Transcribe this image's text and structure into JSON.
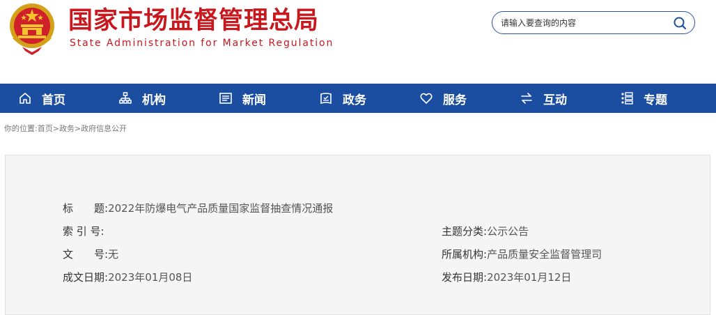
{
  "header": {
    "title": "国家市场监督管理总局",
    "subtitle": "State Administration for Market Regulation",
    "emblem": "national-emblem"
  },
  "search": {
    "placeholder": "请输入要查询的内容",
    "icon": "search-icon"
  },
  "nav": {
    "items": [
      {
        "label": "首页",
        "icon": "home-icon"
      },
      {
        "label": "机构",
        "icon": "org-chart-icon"
      },
      {
        "label": "新闻",
        "icon": "newspaper-icon"
      },
      {
        "label": "政务",
        "icon": "book-icon"
      },
      {
        "label": "服务",
        "icon": "heart-icon"
      },
      {
        "label": "互动",
        "icon": "swap-icon"
      },
      {
        "label": "专题",
        "icon": "topics-icon"
      }
    ]
  },
  "breadcrumb": {
    "prefix": "你的位置:",
    "items": [
      "首页",
      "政务",
      "政府信息公开"
    ],
    "separator": ">"
  },
  "info": {
    "title_label": "标　　题:",
    "title_value": "2022年防爆电气产品质量国家监督抽查情况通报",
    "index_label": "索 引 号:",
    "index_value": "",
    "doc_no_label": "文　　号:",
    "doc_no_value": "无",
    "created_label": "成文日期:",
    "created_value": "2023年01月08日",
    "topic_label": "主题分类:",
    "topic_value": "公示公告",
    "org_label": "所属机构:",
    "org_value": "产品质量安全监督管理司",
    "published_label": "发布日期:",
    "published_value": "2023年01月12日"
  },
  "colors": {
    "brand_red": "#c9171e",
    "nav_blue": "#1b4ea1",
    "panel_bg": "#f5f5f5"
  }
}
